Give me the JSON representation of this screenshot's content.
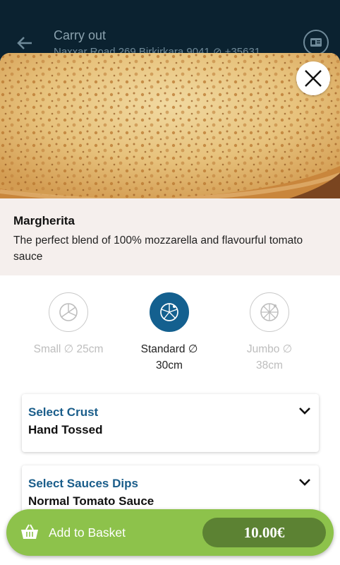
{
  "header": {
    "title": "Carry out",
    "subtitle": "Naxxar Road 269 Birkirkara 9041 ⊘ +35631..."
  },
  "product": {
    "name": "Margherita",
    "description": "The perfect blend of 100% mozzarella and flavourful tomato sauce"
  },
  "sizes": [
    {
      "label": "Small ∅ 25cm",
      "selected": false
    },
    {
      "label": "Standard ∅ 30cm",
      "selected": true
    },
    {
      "label": "Jumbo ∅ 38cm",
      "selected": false
    }
  ],
  "options": [
    {
      "heading": "Select Crust",
      "value": "Hand Tossed"
    },
    {
      "heading": "Select Sauces Dips",
      "value": "Normal Tomato Sauce"
    }
  ],
  "basket": {
    "label": "Add to Basket",
    "price": "10.00€"
  },
  "colors": {
    "accent_blue": "#14608f",
    "basket_green": "#8dc24b",
    "price_green": "#5c8233",
    "header_bg": "#0b2230"
  }
}
